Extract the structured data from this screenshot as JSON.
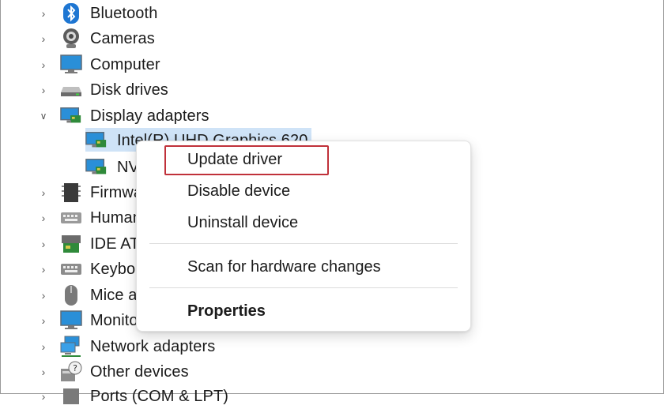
{
  "tree": {
    "items": [
      {
        "label": "Bluetooth",
        "icon": "bluetooth-icon",
        "expanded": false
      },
      {
        "label": "Cameras",
        "icon": "camera-icon",
        "expanded": false
      },
      {
        "label": "Computer",
        "icon": "computer-icon",
        "expanded": false
      },
      {
        "label": "Disk drives",
        "icon": "disk-drive-icon",
        "expanded": false
      },
      {
        "label": "Display adapters",
        "icon": "display-adapter-icon",
        "expanded": true
      },
      {
        "label": "Intel(R) UHD Graphics 620",
        "icon": "display-adapter-icon",
        "child": true,
        "selected": true
      },
      {
        "label": "NVIDIA",
        "icon": "display-adapter-icon",
        "child": true
      },
      {
        "label": "Firmware",
        "icon": "firmware-icon",
        "expanded": false
      },
      {
        "label": "Human Interface Devices",
        "icon": "keyboard-icon",
        "expanded": false
      },
      {
        "label": "IDE ATA/ATAPI controllers",
        "icon": "ide-controller-icon",
        "expanded": false
      },
      {
        "label": "Keyboards",
        "icon": "keyboard-icon",
        "expanded": false
      },
      {
        "label": "Mice and other pointing devices",
        "icon": "mouse-icon",
        "expanded": false
      },
      {
        "label": "Monitors",
        "icon": "monitor-icon",
        "expanded": false
      },
      {
        "label": "Network adapters",
        "icon": "network-icon",
        "expanded": false
      },
      {
        "label": "Other devices",
        "icon": "unknown-device-icon",
        "expanded": false
      },
      {
        "label": "Ports (COM & LPT)",
        "icon": "port-icon",
        "expanded": false
      }
    ]
  },
  "context_menu": {
    "update_driver": "Update driver",
    "disable_device": "Disable device",
    "uninstall_device": "Uninstall device",
    "scan_hardware": "Scan for hardware changes",
    "properties": "Properties"
  },
  "colors": {
    "highlight_box": "#c0313a",
    "selection": "#cfe3f7",
    "accent": "#0078d4"
  }
}
